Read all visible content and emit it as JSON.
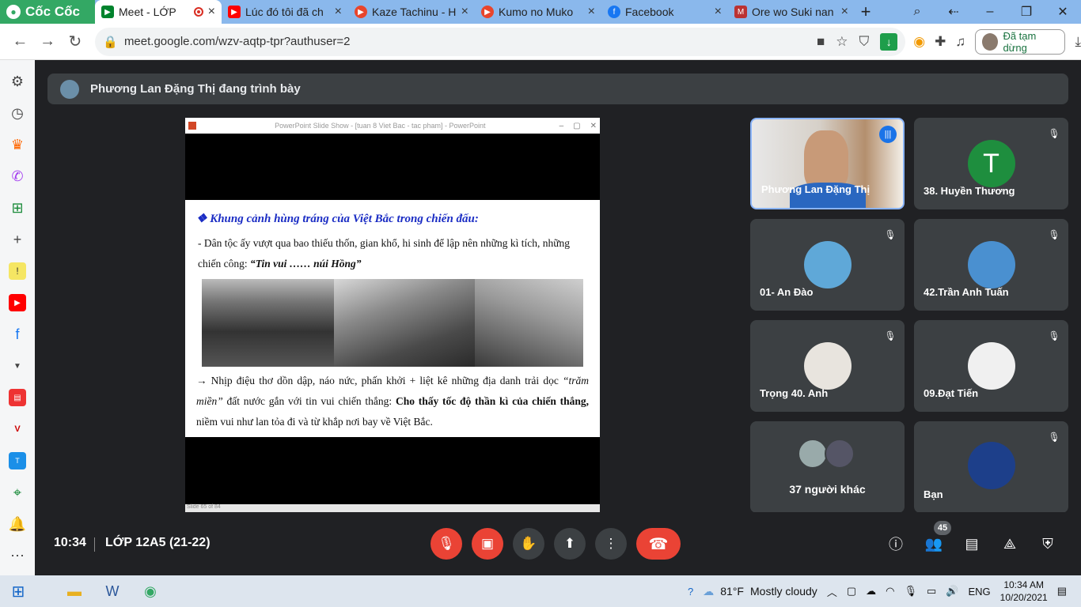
{
  "browser": {
    "brand": "Cốc Cốc",
    "tabs": [
      {
        "label": "Meet - LỚP",
        "icon": "meet-icon"
      },
      {
        "label": "Lúc đó tôi đã ch",
        "icon": "youtube-icon"
      },
      {
        "label": "Kaze Tachinu - H",
        "icon": "play-icon"
      },
      {
        "label": "Kumo no Muko",
        "icon": "play-icon"
      },
      {
        "label": "Facebook",
        "icon": "facebook-icon"
      },
      {
        "label": "Ore wo Suki nan",
        "icon": "manga-icon"
      }
    ],
    "url": "meet.google.com/wzv-aqtp-tpr?authuser=2",
    "profile_status": "Đã tạm dừng"
  },
  "meet": {
    "presenting_banner": "Phương Lan Đặng Thị đang trình bày",
    "slide": {
      "window_title": "PowerPoint Slide Show - [tuan 8 Viet Bac - tac pham] - PowerPoint",
      "heading": "❖ Khung cảnh hùng tráng của Việt Bắc trong chiến đấu:",
      "para1_text": " - Dân tộc ấy vượt qua bao thiếu thốn, gian khổ, hi sinh để lập nên những kì tích, những chiến công: ",
      "para1_quote": "“Tin vui …… núi Hồng”",
      "para2_a": "→ Nhịp điệu thơ dồn dập, náo nức, phấn khởi + liệt kê những địa danh trải dọc ",
      "para2_b": "“trăm miền”",
      "para2_c": " đất nước gắn với tin vui chiến thắng: ",
      "para2_d": "Cho thấy tốc độ thần kì của chiến thắng,",
      "para2_e": " niềm vui như lan tỏa đi và từ khắp nơi bay về Việt Bắc.",
      "status": "Slide 65 of 84"
    },
    "participants": [
      {
        "name": "Phương Lan Đặng Thị"
      },
      {
        "name": "38. Huyền Thương",
        "initial": "T",
        "color": "#1e8e3e"
      },
      {
        "name": "01- An Đào"
      },
      {
        "name": "42.Trần Anh Tuấn"
      },
      {
        "name": "Trọng 40. Anh"
      },
      {
        "name": "09.Đạt Tiến"
      },
      {
        "name": "37 người khác"
      },
      {
        "name": "Bạn"
      }
    ],
    "bottom": {
      "time": "10:34",
      "meeting_name": "LỚP 12A5 (21-22)",
      "participant_count": "45"
    }
  },
  "taskbar": {
    "weather_temp": "81°F",
    "weather_desc": "Mostly cloudy",
    "language": "ENG",
    "time": "10:34 AM",
    "date": "10/20/2021"
  }
}
